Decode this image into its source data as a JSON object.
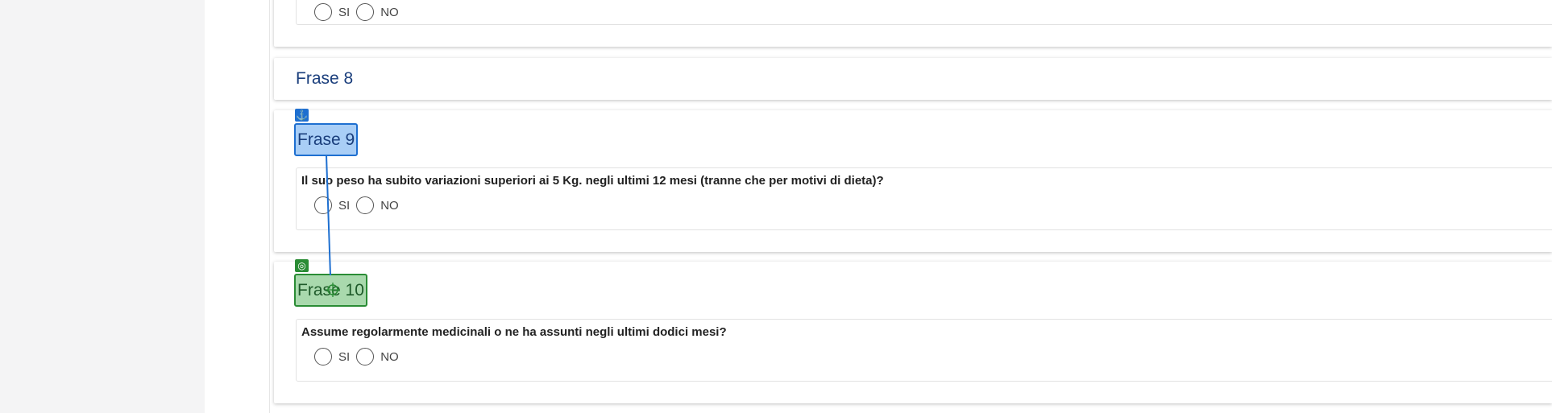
{
  "sections": [
    {
      "id": "prev",
      "options": [
        {
          "label": "SI"
        },
        {
          "label": "NO"
        }
      ]
    },
    {
      "id": "frase8",
      "title": "Frase 8"
    },
    {
      "id": "frase9",
      "title": "Frase 9",
      "question": "Il suo peso ha subito variazioni superiori ai 5 Kg. negli ultimi 12 mesi (tranne che per motivi di dieta)?",
      "options": [
        {
          "label": "SI"
        },
        {
          "label": "NO"
        }
      ]
    },
    {
      "id": "frase10",
      "title": "Frase 10",
      "question": "Assume regolarmente medicinali o ne ha assunti negli ultimi dodici mesi?",
      "options": [
        {
          "label": "SI"
        },
        {
          "label": "NO"
        }
      ]
    }
  ],
  "overlay": {
    "anchor_icon": "anchor-icon",
    "target_icon": "target-icon",
    "drag_icon": "move-icon",
    "anchor_color": "#1e6fd0",
    "target_color": "#2a8c35"
  }
}
